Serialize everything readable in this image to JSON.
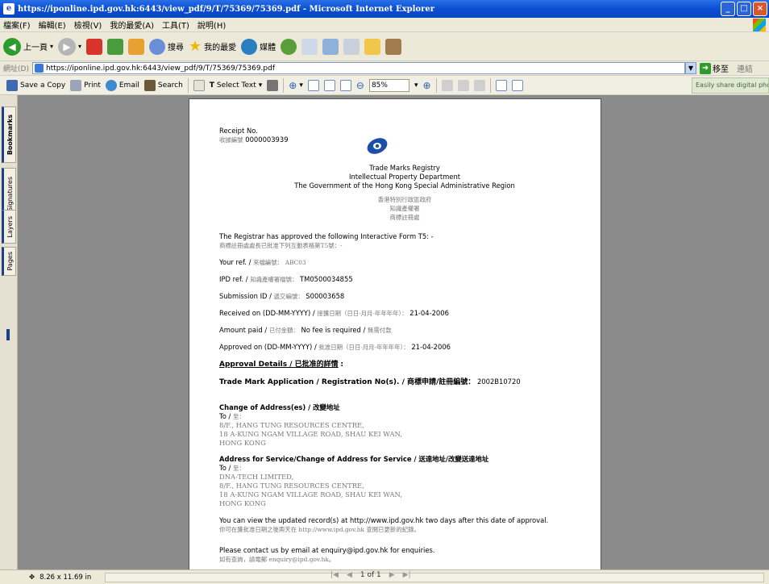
{
  "window": {
    "title": "https://iponline.ipd.gov.hk:6443/view_pdf/9/T/75369/75369.pdf - Microsoft Internet Explorer"
  },
  "menu": [
    "檔案(F)",
    "編輯(E)",
    "檢視(V)",
    "我的最愛(A)",
    "工具(T)",
    "說明(H)"
  ],
  "ie_toolbar": {
    "back_label": "上一頁",
    "search_label": "搜尋",
    "favorites_label": "我的最愛",
    "media_label": "媒體"
  },
  "address": {
    "label": "網址(D)",
    "url": "https://iponline.ipd.gov.hk:6443/view_pdf/9/T/75369/75369.pdf",
    "go_label": "移至",
    "links_label": "連結"
  },
  "acrobat": {
    "save_copy": "Save a Copy",
    "print": "Print",
    "email": "Email",
    "search": "Search",
    "select_text": "Select Text",
    "zoom": "85%",
    "share_banner": "Easily share digital photo"
  },
  "navtabs": [
    "Bookmarks",
    "Signatures",
    "Layers",
    "Pages"
  ],
  "document": {
    "receipt_label": "Receipt No.",
    "receipt_cn": "收據編號",
    "receipt_no": "0000003939",
    "org_en": [
      "Trade Marks Registry",
      "Intellectual Property Department",
      "The Government of the Hong Kong Special Administrative Region"
    ],
    "org_cn": [
      "香港特別行政區政府",
      "知識產權署",
      "商標註冊處"
    ],
    "intro_en": "The Registrar has approved the following Interactive Form T5: -",
    "intro_cn": "商標註冊處處長已批准下列互動表格第T5號：-",
    "your_ref_label": "Your ref. /",
    "your_ref_cn": "來檔編號：",
    "your_ref": "ABC03",
    "ipd_ref_label": "IPD ref. /",
    "ipd_ref_cn": "知識產權署檔號：",
    "ipd_ref": "TM0500034855",
    "submission_label": "Submission ID /",
    "submission_cn": "遞交編號：",
    "submission_id": "S00003658",
    "received_label": "Received on (DD-MM-YYYY) /",
    "received_cn": "接獲日期（日日-月月-年年年年）：",
    "received": "21-04-2006",
    "amount_label": "Amount paid /",
    "amount_cn": "已付金額：",
    "amount": "No fee is required /",
    "amount_cn2": "無需付款",
    "approved_label": "Approved on (DD-MM-YYYY) /",
    "approved_cn": "批准日期（日日-月月-年年年年）：",
    "approved": "21-04-2006",
    "approval_heading": "Approval Details / 已批准的詳情",
    "approval_colon": ":",
    "tm_app_label": "Trade Mark Application / Registration No(s). / 商標申請/註冊編號：",
    "tm_app_no": "2002B10720",
    "change_heading": "Change of Address(es) / 改變地址",
    "to_label": "To /",
    "to_cn": "至：",
    "change_address": [
      "8/F., HANG TUNG RESOURCES CENTRE,",
      "18 A-KUNG NGAM VILLAGE ROAD, SHAU KEI WAN,",
      "HONG KONG"
    ],
    "service_heading": "Address for Service/Change of Address for Service / 送達地址/改變送達地址",
    "service_address": [
      "DNA-TECH LIMITED,",
      "8/F., HANG TUNG RESOURCES CENTRE,",
      "18 A-KUNG NGAM VILLAGE ROAD, SHAU KEI WAN,",
      "HONG KONG"
    ],
    "view_en": "You can view the updated record(s) at http://www.ipd.gov.hk two days after this date of approval.",
    "view_cn": "你可在獲批准日期之後兩天在 http://www.ipd.gov.hk 查閱已更新的紀錄。",
    "contact_en": "Please contact us by email at enquiry@ipd.gov.hk for enquiries.",
    "contact_cn": "如有查詢，請電郵 enquiry@ipd.gov.hk。"
  },
  "status": {
    "page_size": "8.26 x 11.69 in",
    "page_of": "1 of 1"
  }
}
